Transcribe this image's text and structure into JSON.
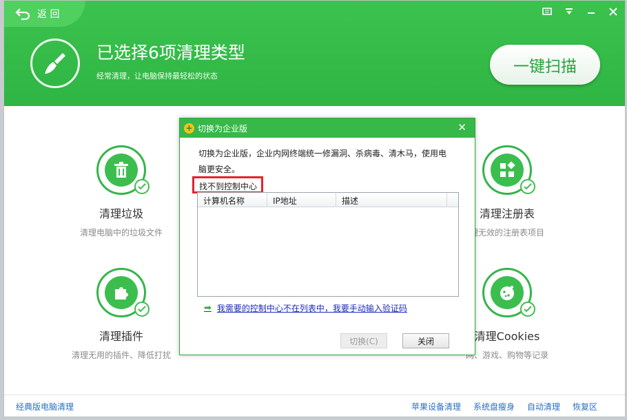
{
  "header": {
    "back_label": "返 回",
    "title": "已选择6项清理类型",
    "subtitle": "经常清理，让电脑保持最轻松的状态",
    "scan_label": "一键扫描"
  },
  "tiles": [
    {
      "name": "清理垃圾",
      "desc": "清理电脑中的垃圾文件"
    },
    {
      "name": "清理注册表",
      "desc": "理无效的注册表项目"
    },
    {
      "name": "清理插件",
      "desc": "清理无用的插件、降低打扰"
    },
    {
      "name": "清理Cookies",
      "desc": "网、游戏、购物等记录"
    }
  ],
  "bottom": {
    "left_link": "经典版电脑清理",
    "right_links": [
      "苹果设备清理",
      "系统盘瘦身",
      "自动清理",
      "恢复区"
    ]
  },
  "dialog": {
    "title": "切换为企业版",
    "message": "切换为企业版，企业内网终端统一修漏洞、杀病毒、清木马，使用电脑更安全。",
    "highlight": "找不到控制中心",
    "columns": [
      "计算机名称",
      "IP地址",
      "描述"
    ],
    "link": "我需要的控制中心不在列表中，我要手动输入验证码",
    "switch_label": "切换(C)",
    "close_label": "关闭"
  },
  "colors": {
    "brand_green": "#37b848",
    "highlight_red": "#e8212c",
    "link_blue": "#1d2bbf"
  }
}
